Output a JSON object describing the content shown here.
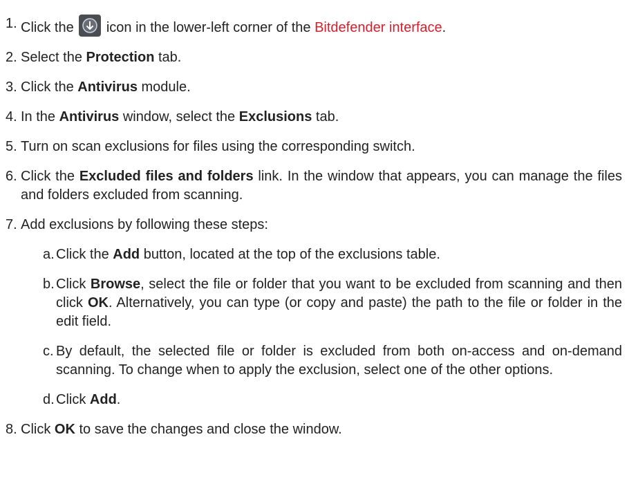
{
  "steps": [
    {
      "n": "1.",
      "t1": "Click the",
      "icon": "download-circle-icon",
      "t2": "icon in the lower-left corner of the",
      "link": "Bitdefender interface",
      "t3": "."
    },
    {
      "n": "2.",
      "t1": "Select the",
      "b1": "Protection",
      "t2": "tab."
    },
    {
      "n": "3.",
      "t1": "Click the",
      "b1": "Antivirus",
      "t2": "module."
    },
    {
      "n": "4.",
      "t1": "In the",
      "b1": "Antivirus",
      "t2": "window, select the",
      "b2": "Exclusions",
      "t3": "tab."
    },
    {
      "n": "5.",
      "t1": "Turn on scan exclusions for files using the corresponding switch."
    },
    {
      "n": "6.",
      "t1": "Click the",
      "b1": "Excluded files and folders",
      "t2": "link. In the window that appears, you can manage the files and folders excluded from scanning."
    },
    {
      "n": "7.",
      "t1": "Add exclusions by following these steps:",
      "sub": [
        {
          "n": "a.",
          "t1": "Click the",
          "b1": "Add",
          "t2": "button, located at the top of the exclusions table."
        },
        {
          "n": "b.",
          "t1": "Click",
          "b1": "Browse",
          "t2": ", select the file or folder that you want to be excluded from scanning and then click",
          "b2": "OK",
          "t3": ". Alternatively, you can type (or copy and paste) the path to the file or folder in the edit field."
        },
        {
          "n": "c.",
          "t1": "By default, the selected file or folder is excluded from both on-access and on-demand scanning. To change when to apply the exclusion, select one of the other options."
        },
        {
          "n": "d.",
          "t1": "Click",
          "b1": "Add",
          "t2": "."
        }
      ]
    },
    {
      "n": "8.",
      "t1": "Click",
      "b1": "OK",
      "t2": "to save the changes and close the window."
    }
  ]
}
